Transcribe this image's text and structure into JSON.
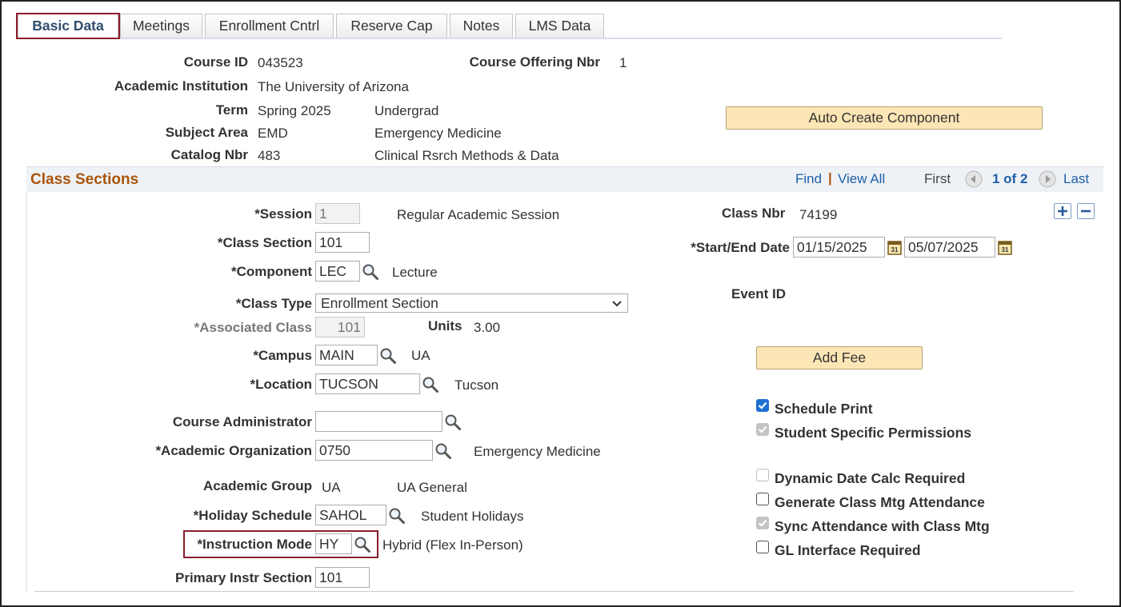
{
  "tabs": [
    {
      "label": "Basic Data"
    },
    {
      "label": "Meetings"
    },
    {
      "label": "Enrollment Cntrl"
    },
    {
      "label": "Reserve Cap"
    },
    {
      "label": "Notes"
    },
    {
      "label": "LMS Data"
    }
  ],
  "header": {
    "course_id_label": "Course ID",
    "course_id": "043523",
    "offering_label": "Course Offering Nbr",
    "offering": "1",
    "institution_label": "Academic Institution",
    "institution": "The University of Arizona",
    "term_label": "Term",
    "term": "Spring 2025",
    "career": "Undergrad",
    "subject_label": "Subject Area",
    "subject": "EMD",
    "subject_desc": "Emergency Medicine",
    "catalog_label": "Catalog Nbr",
    "catalog": "483",
    "catalog_desc": "Clinical Rsrch Methods & Data",
    "auto_create_label": "Auto Create Component"
  },
  "section": {
    "title": "Class Sections",
    "find": "Find",
    "sep": "|",
    "view_all": "View All",
    "first": "First",
    "pager": "1 of 2",
    "last": "Last"
  },
  "form": {
    "session_label": "*Session",
    "session": "1",
    "session_desc": "Regular Academic Session",
    "class_section_label": "*Class Section",
    "class_section": "101",
    "component_label": "*Component",
    "component": "LEC",
    "component_desc": "Lecture",
    "class_type_label": "*Class Type",
    "class_type": "Enrollment Section",
    "assoc_label": "*Associated Class",
    "assoc": "101",
    "units_label": "Units",
    "units": "3.00",
    "campus_label": "*Campus",
    "campus": "MAIN",
    "campus_desc": "UA",
    "location_label": "*Location",
    "location": "TUCSON",
    "location_desc": "Tucson",
    "admin_label": "Course Administrator",
    "admin": "",
    "org_label": "*Academic Organization",
    "org": "0750",
    "org_desc": "Emergency Medicine",
    "group_label": "Academic Group",
    "group": "UA",
    "group_desc": "UA General",
    "holiday_label": "*Holiday Schedule",
    "holiday": "SAHOL",
    "holiday_desc": "Student Holidays",
    "mode_label": "*Instruction Mode",
    "mode": "HY",
    "mode_desc": "Hybrid (Flex In-Person)",
    "primary_label": "Primary Instr Section",
    "primary": "101",
    "class_nbr_label": "Class Nbr",
    "class_nbr": "74199",
    "dates_label": "*Start/End Date",
    "start_date": "01/15/2025",
    "end_date": "05/07/2025",
    "event_label": "Event ID",
    "add_fee_label": "Add Fee"
  },
  "checkboxes": {
    "schedule_print": "Schedule Print",
    "student_perm": "Student Specific Permissions",
    "dynamic_date": "Dynamic Date Calc Required",
    "gen_attendance": "Generate Class Mtg Attendance",
    "sync_attendance": "Sync Attendance with Class Mtg",
    "gl_interface": "GL Interface Required"
  }
}
